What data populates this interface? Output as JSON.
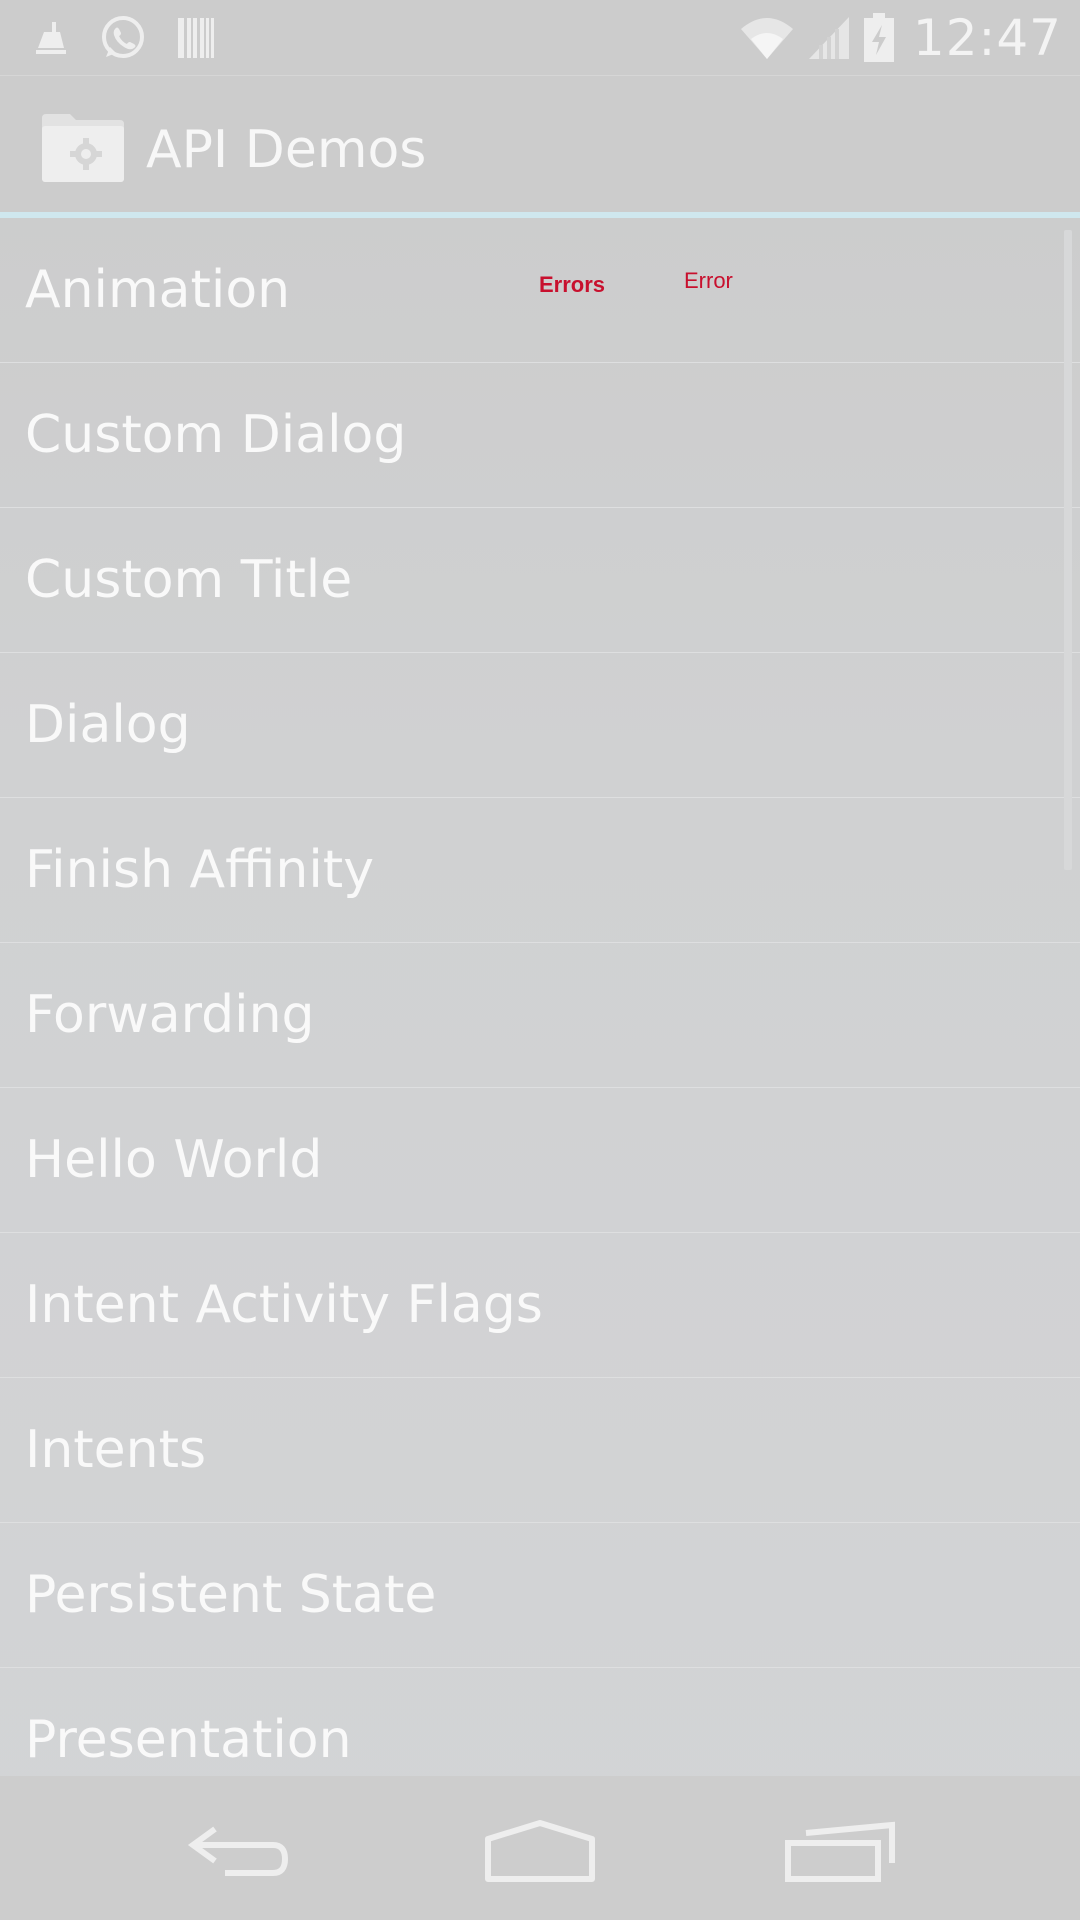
{
  "status_bar": {
    "time": "12:47",
    "left_icons": [
      "cleaner-icon",
      "whatsapp-icon",
      "barcode-icon"
    ],
    "right_icons": [
      "wifi-icon",
      "signal-icon",
      "battery-charging-icon"
    ]
  },
  "action_bar": {
    "title": "API Demos",
    "logo_icon": "folder-gear-icon"
  },
  "list": {
    "items": [
      {
        "label": "Animation"
      },
      {
        "label": "Custom Dialog"
      },
      {
        "label": "Custom Title"
      },
      {
        "label": "Dialog"
      },
      {
        "label": "Finish Affinity"
      },
      {
        "label": "Forwarding"
      },
      {
        "label": "Hello World"
      },
      {
        "label": "Intent Activity Flags"
      },
      {
        "label": "Intents"
      },
      {
        "label": "Persistent State"
      },
      {
        "label": "Presentation"
      }
    ]
  },
  "overlays": {
    "errors_label": "Errors",
    "error_label": "Error",
    "color": "#c8102e"
  },
  "nav_bar": {
    "buttons": [
      "back-icon",
      "home-icon",
      "recent-apps-icon"
    ]
  }
}
